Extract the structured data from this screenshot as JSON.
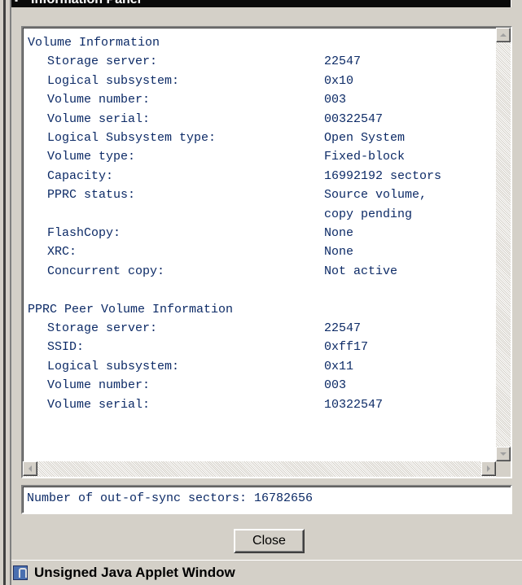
{
  "window": {
    "title": "Information Panel"
  },
  "volume_info": {
    "heading": "Volume Information",
    "rows": [
      {
        "label": "Storage server:",
        "value": "22547"
      },
      {
        "label": "Logical subsystem:",
        "value": "0x10"
      },
      {
        "label": "Volume number:",
        "value": "003"
      },
      {
        "label": "Volume serial:",
        "value": "00322547"
      },
      {
        "label": "Logical Subsystem type:",
        "value": "Open System"
      },
      {
        "label": "Volume type:",
        "value": "Fixed-block"
      },
      {
        "label": "Capacity:",
        "value": "16992192 sectors"
      },
      {
        "label": "PPRC status:",
        "value": "Source volume,"
      },
      {
        "label": "",
        "value": "copy pending"
      },
      {
        "label": "FlashCopy:",
        "value": "None"
      },
      {
        "label": "XRC:",
        "value": "None"
      },
      {
        "label": "Concurrent copy:",
        "value": "Not active"
      }
    ]
  },
  "peer_info": {
    "heading": "PPRC Peer Volume Information",
    "rows": [
      {
        "label": "Storage server:",
        "value": "22547"
      },
      {
        "label": "SSID:",
        "value": "0xff17"
      },
      {
        "label": "Logical subsystem:",
        "value": "0x11"
      },
      {
        "label": "Volume number:",
        "value": "003"
      },
      {
        "label": "Volume serial:",
        "value": "10322547"
      }
    ]
  },
  "sync": {
    "text": "Number of out-of-sync sectors: 16782656"
  },
  "buttons": {
    "close_label": "Close"
  },
  "statusbar": {
    "text": "Unsigned Java Applet Window",
    "icon": "java-applet-icon"
  },
  "colors": {
    "text": "#0c2a66",
    "background": "#d4d0c8"
  }
}
